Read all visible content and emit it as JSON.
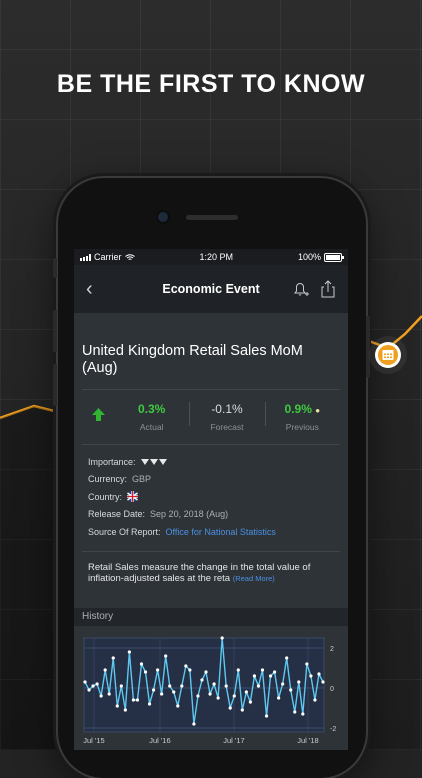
{
  "headline": "BE THE FIRST TO KNOW",
  "status": {
    "carrier": "Carrier",
    "time": "1:20 PM",
    "battery": "100%"
  },
  "nav": {
    "title": "Economic Event"
  },
  "event": {
    "title": "United Kingdom Retail Sales MoM (Aug)",
    "actual_value": "0.3%",
    "actual_label": "Actual",
    "forecast_value": "-0.1%",
    "forecast_label": "Forecast",
    "previous_value": "0.9%",
    "previous_label": "Previous",
    "importance_label": "Importance:",
    "currency_label": "Currency:",
    "currency_value": "GBP",
    "country_label": "Country:",
    "release_label": "Release Date:",
    "release_value": "Sep 20, 2018 (Aug)",
    "source_label": "Source Of Report:",
    "source_value": "Office for National Statistics",
    "description": "Retail Sales measure the change in the total value of inflation-adjusted sales at the reta",
    "read_more": "(Read More)"
  },
  "history": {
    "label": "History"
  },
  "colors": {
    "accent_green": "#3fca3f",
    "link_blue": "#4a90e2",
    "chart_line": "#5ec8f0",
    "bg_line": "#f0a020"
  },
  "chart_data": {
    "type": "line",
    "x_ticks": [
      "Jul '15",
      "Jul '16",
      "Jul '17",
      "Jul '18"
    ],
    "y_ticks": [
      "2",
      "0",
      "-2"
    ],
    "ylim": [
      -2.2,
      2.5
    ],
    "values": [
      0.3,
      -0.1,
      0.1,
      0.2,
      -0.4,
      0.9,
      -0.3,
      1.5,
      -0.9,
      0.1,
      -1.1,
      1.8,
      -0.6,
      -0.6,
      1.2,
      0.8,
      -0.8,
      -0.1,
      0.9,
      -0.3,
      1.6,
      0.1,
      -0.2,
      -0.9,
      0.1,
      1.1,
      0.9,
      -1.8,
      -0.4,
      0.4,
      0.8,
      -0.3,
      0.2,
      -0.5,
      2.5,
      0.1,
      -1.0,
      -0.4,
      0.9,
      -1.1,
      -0.2,
      -0.7,
      0.6,
      0.1,
      0.9,
      -1.4,
      0.6,
      0.8,
      -0.5,
      0.2,
      1.5,
      -0.1,
      -1.2,
      0.3,
      -1.3,
      1.2,
      0.6,
      -0.6,
      0.7,
      0.3
    ],
    "grid": true,
    "legend": "none"
  }
}
